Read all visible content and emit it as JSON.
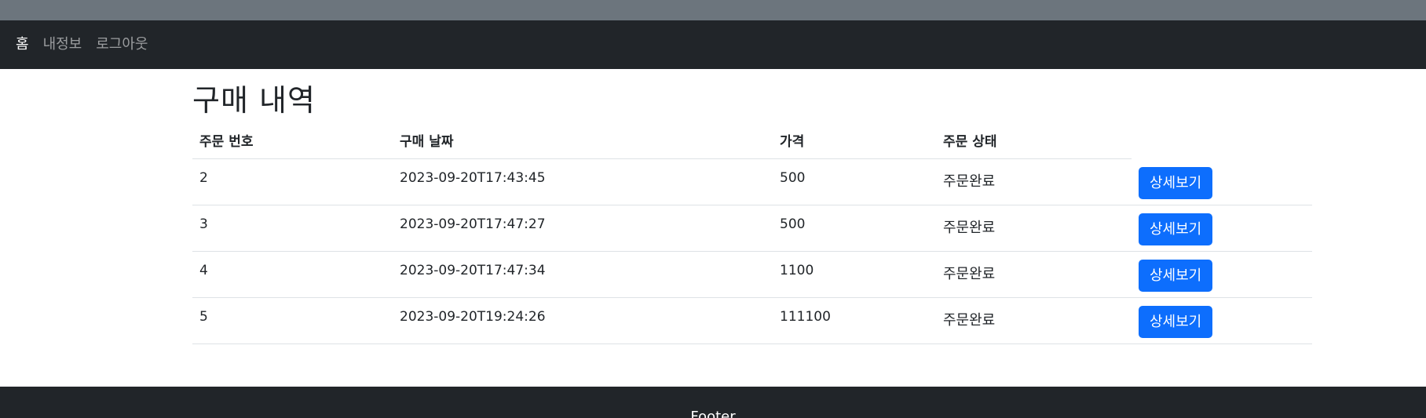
{
  "nav": {
    "links": [
      {
        "label": "홈",
        "active": true
      },
      {
        "label": "내정보",
        "active": false
      },
      {
        "label": "로그아웃",
        "active": false
      }
    ]
  },
  "page": {
    "title": "구매 내역"
  },
  "table": {
    "headers": [
      "주문 번호",
      "구매 날짜",
      "가격",
      "주문 상태",
      ""
    ],
    "rows": [
      {
        "order_no": "2",
        "date": "2023-09-20T17:43:45",
        "price": "500",
        "status": "주문완료",
        "action": "상세보기"
      },
      {
        "order_no": "3",
        "date": "2023-09-20T17:47:27",
        "price": "500",
        "status": "주문완료",
        "action": "상세보기"
      },
      {
        "order_no": "4",
        "date": "2023-09-20T17:47:34",
        "price": "1100",
        "status": "주문완료",
        "action": "상세보기"
      },
      {
        "order_no": "5",
        "date": "2023-09-20T19:24:26",
        "price": "111100",
        "status": "주문완료",
        "action": "상세보기"
      }
    ]
  },
  "footer": {
    "text": "Footer"
  },
  "colors": {
    "top_strip": "#6c757d",
    "navbar": "#212529",
    "primary_button": "#0d6efd",
    "footer": "#212529"
  }
}
